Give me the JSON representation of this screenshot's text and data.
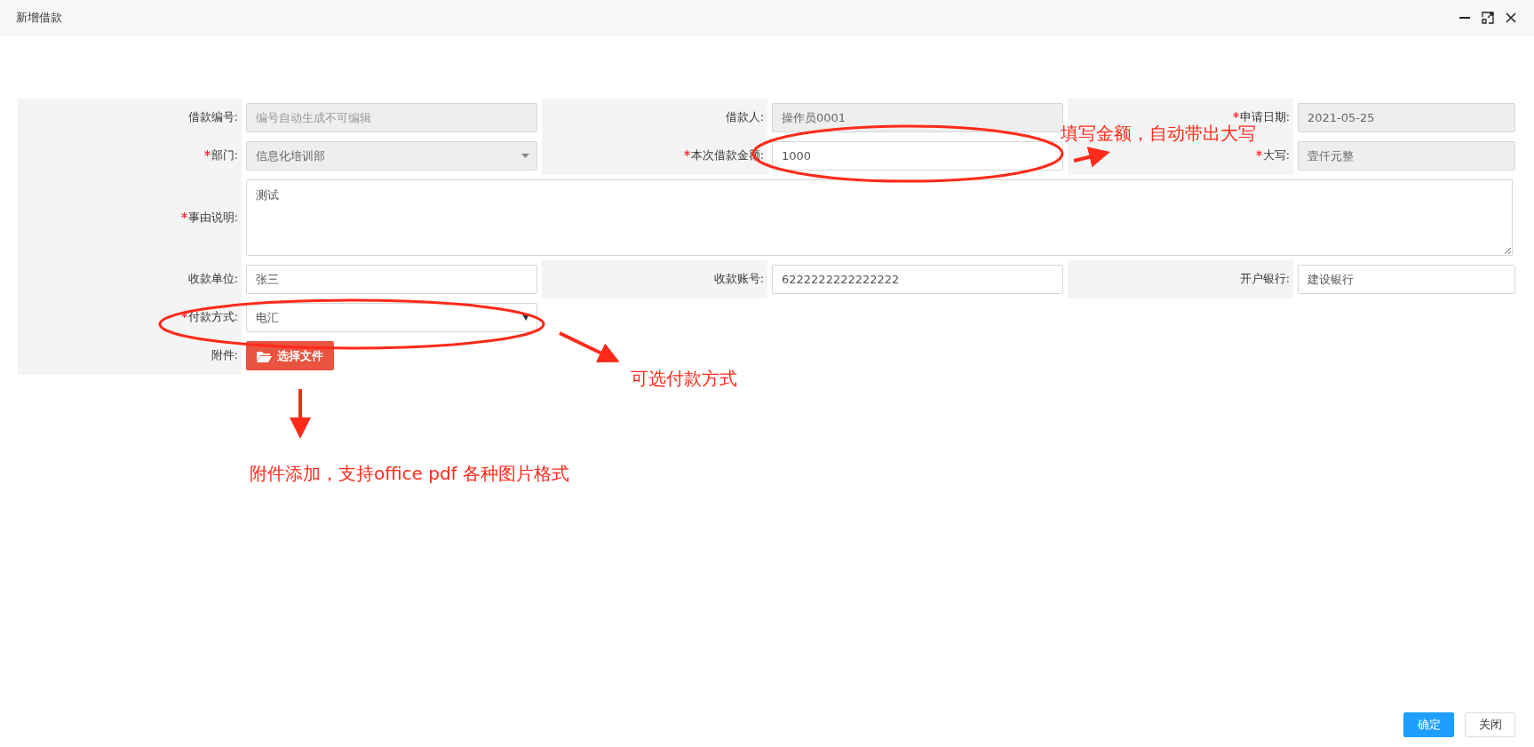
{
  "window": {
    "title": "新增借款"
  },
  "form": {
    "rows": [
      {
        "fields": [
          {
            "label": "借款编号:",
            "required": false,
            "kind": "text",
            "placeholder": "编号自动生成不可编辑",
            "disabled": true
          },
          {
            "label": "借款人:",
            "required": false,
            "kind": "text",
            "value": "操作员0001",
            "disabled": true
          },
          {
            "label": "申请日期:",
            "required": true,
            "kind": "text",
            "value": "2021-05-25",
            "disabled": true
          }
        ]
      },
      {
        "fields": [
          {
            "label": "部门:",
            "required": true,
            "kind": "select",
            "value": "信息化培训部",
            "disabled": true
          },
          {
            "label": "本次借款金额:",
            "required": true,
            "kind": "text",
            "value": "1000",
            "disabled": false
          },
          {
            "label": "大写:",
            "required": true,
            "kind": "text",
            "value": "壹仟元整",
            "disabled": true
          }
        ]
      },
      {
        "fields": [
          {
            "label": "事由说明:",
            "required": true,
            "kind": "textarea",
            "value": "测试"
          }
        ]
      },
      {
        "fields": [
          {
            "label": "收款单位:",
            "required": false,
            "kind": "text",
            "value": "张三",
            "disabled": false
          },
          {
            "label": "收款账号:",
            "required": false,
            "kind": "text",
            "value": "6222222222222222",
            "disabled": false
          },
          {
            "label": "开户银行:",
            "required": false,
            "kind": "text",
            "value": "建设银行",
            "disabled": false
          }
        ]
      },
      {
        "fields": [
          {
            "label": "付款方式:",
            "required": true,
            "kind": "select",
            "value": "电汇",
            "disabled": false
          }
        ]
      },
      {
        "fields": [
          {
            "label": "附件:",
            "required": false,
            "kind": "file",
            "value": "选择文件"
          }
        ]
      }
    ]
  },
  "annotations": [
    "填写金额，自动带出大写",
    "可选付款方式",
    "附件添加，支持office pdf 各种图片格式"
  ],
  "buttons": [
    {
      "label": "确定",
      "kind": "primary"
    },
    {
      "label": "关闭",
      "kind": "default"
    }
  ]
}
